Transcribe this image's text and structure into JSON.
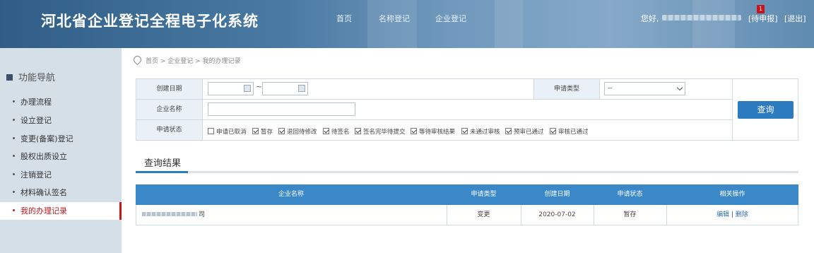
{
  "header": {
    "system_title": "河北省企业登记全程电子化系统",
    "nav": [
      "首页",
      "名称登记",
      "企业登记"
    ],
    "greeting": "您好,",
    "pending_label": "[待申报]",
    "pending_count": "1",
    "logout_label": "[退出]"
  },
  "sidebar": {
    "title": "功能导航",
    "items": [
      {
        "label": "办理流程"
      },
      {
        "label": "设立登记"
      },
      {
        "label": "变更(备案)登记"
      },
      {
        "label": "股权出质设立"
      },
      {
        "label": "注销登记"
      },
      {
        "label": "材料确认签名"
      },
      {
        "label": "我的办理记录",
        "active": true
      }
    ]
  },
  "breadcrumb": "首页 > 企业登记 > 我的办理记录",
  "form": {
    "create_date_label": "创建日期",
    "range_sep": "~",
    "app_type_label": "申请类型",
    "app_type_value": "--",
    "company_name_label": "企业名称",
    "status_label": "申请状态",
    "query_button": "查询",
    "statuses": [
      {
        "label": "申请已取消",
        "checked": false
      },
      {
        "label": "暂存",
        "checked": true
      },
      {
        "label": "退回待修改",
        "checked": true
      },
      {
        "label": "待签名",
        "checked": true
      },
      {
        "label": "签名完毕待提交",
        "checked": true
      },
      {
        "label": "等待审核结果",
        "checked": true
      },
      {
        "label": "未通过审核",
        "checked": true
      },
      {
        "label": "预审已通过",
        "checked": true
      },
      {
        "label": "审核已通过",
        "checked": true
      }
    ]
  },
  "results": {
    "title": "查询结果",
    "columns": [
      "企业名称",
      "申请类型",
      "创建日期",
      "申请状态",
      "相关操作"
    ],
    "rows": [
      {
        "company_suffix": "司",
        "type": "变更",
        "date": "2020-07-02",
        "status": "暂存",
        "edit": "编辑",
        "sep": "|",
        "delete": "删除"
      }
    ]
  },
  "colors": {
    "accent": "#2c7bc0",
    "active": "#c8161d",
    "table_header": "#3a88c8",
    "sidebar_bg": "#d5dfe8"
  }
}
